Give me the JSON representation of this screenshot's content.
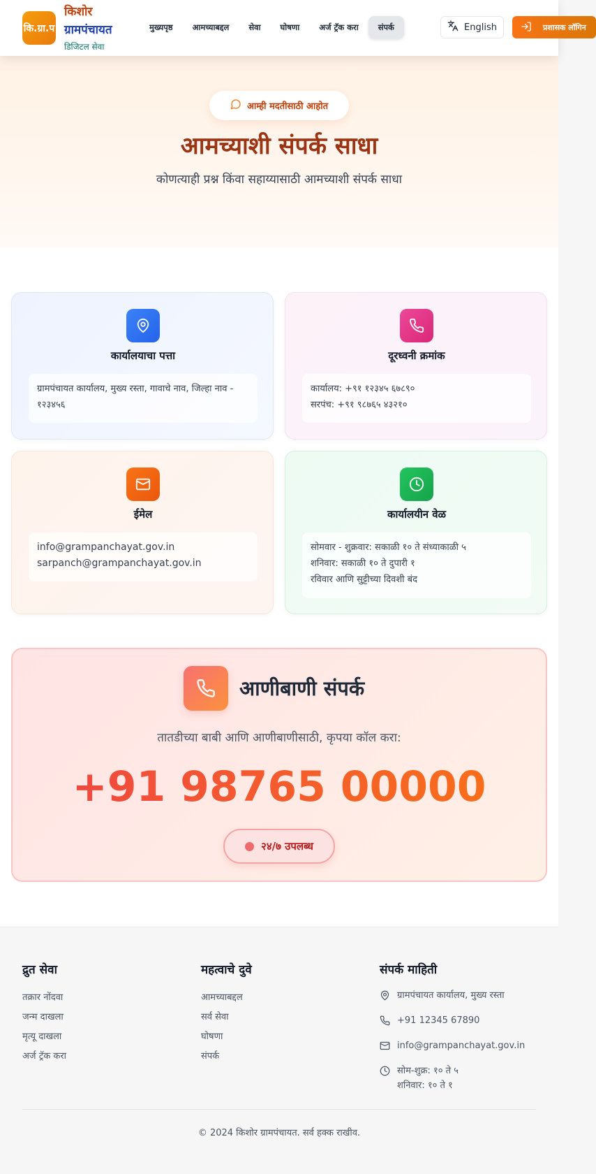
{
  "header": {
    "logo_text": "कि.ग्रा.प",
    "brand_line1": "किशोर",
    "brand_line2": "ग्रामपंचायत",
    "brand_sub": "डिजिटल सेवा",
    "nav": [
      {
        "label": "मुख्यपृष्ठ"
      },
      {
        "label": "आमच्याबद्दल"
      },
      {
        "label": "सेवा"
      },
      {
        "label": "घोषणा"
      },
      {
        "label": "अर्ज ट्रॅक करा"
      },
      {
        "label": "संपर्क"
      }
    ],
    "language_label": "English",
    "login_label": "प्रशासक लॉगिन"
  },
  "hero": {
    "badge": "आम्ही मदतीसाठी आहोत",
    "title": "आमच्याशी संपर्क साधा",
    "subtitle": "कोणत्याही प्रश्न किंवा सहाय्यासाठी आमच्याशी संपर्क साधा"
  },
  "cards": {
    "address": {
      "title": "कार्यालयाचा पत्ता",
      "lines": [
        "ग्रामपंचायत कार्यालय, मुख्य रस्ता, गावाचे नाव, जिल्हा नाव -",
        "१२३४५६"
      ]
    },
    "phone": {
      "title": "दूरध्वनी क्रमांक",
      "lines": [
        "कार्यालय: +९१ १२३४५ ६७८९०",
        "सरपंच: +९१ ९८७६५ ४३२१०"
      ]
    },
    "email": {
      "title": "ईमेल",
      "lines": [
        "info@grampanchayat.gov.in",
        "sarpanch@grampanchayat.gov.in"
      ]
    },
    "hours": {
      "title": "कार्यालयीन वेळ",
      "lines": [
        "सोमवार - शुक्रवार: सकाळी १० ते संध्याकाळी ५",
        "शनिवार: सकाळी १० ते दुपारी १",
        "रविवार आणि सुट्टीच्या दिवशी बंद"
      ]
    }
  },
  "emergency": {
    "title": "आणीबाणी संपर्क",
    "description": "तातडीच्या बाबी आणि आणीबाणीसाठी, कृपया कॉल करा:",
    "number": "+91 98765 00000",
    "availability": "२४/७ उपलब्ध"
  },
  "footer": {
    "quick_services": {
      "heading": "द्रुत सेवा",
      "links": [
        "तक्रार नोंदवा",
        "जन्म दाखला",
        "मृत्यू दाखला",
        "अर्ज ट्रॅक करा"
      ]
    },
    "important_links": {
      "heading": "महत्वाचे दुवे",
      "links": [
        "आमच्याबद्दल",
        "सर्व सेवा",
        "घोषणा",
        "संपर्क"
      ]
    },
    "contact": {
      "heading": "संपर्क माहिती",
      "address": "ग्रामपंचायत कार्यालय, मुख्य रस्ता",
      "phone": "+91 12345 67890",
      "email": "info@grampanchayat.gov.in",
      "hours_line1": "सोम-शुक्र: १० ते ५",
      "hours_line2": "शनिवार: १० ते १"
    },
    "copyright": "© 2024 किशोर ग्रामपंचायत. सर्व हक्क राखीव."
  },
  "icons": {
    "badge": "message-circle-icon",
    "language": "translate-icon",
    "login": "login-icon",
    "address": "map-pin-icon",
    "phone": "phone-icon",
    "email": "mail-icon",
    "hours": "clock-icon"
  },
  "colors": {
    "brand_orange": "#ea580c",
    "brand_blue": "#1e40af",
    "hero_title": "#9a3412",
    "emergency_red": "#ef4444"
  }
}
